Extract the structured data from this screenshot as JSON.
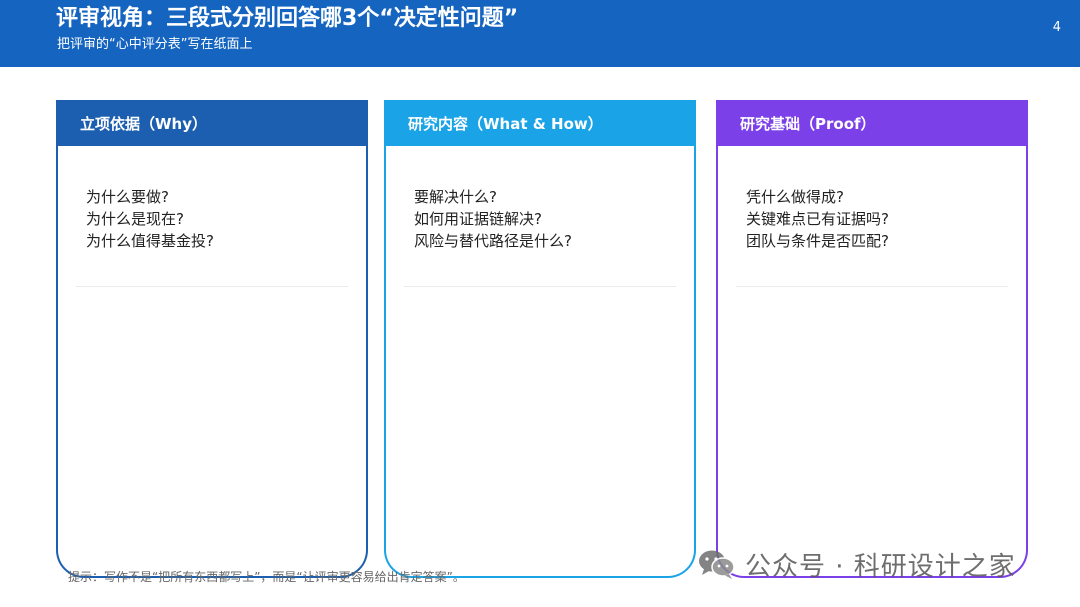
{
  "header": {
    "title": "评审视角：三段式分别回答哪3个“决定性问题”",
    "subtitle": "把评审的“心中评分表”写在纸面上",
    "page_number": "4"
  },
  "cards": [
    {
      "heading": "立项依据（Why）",
      "lines": [
        "为什么要做?",
        "为什么是现在?",
        "为什么值得基金投?"
      ]
    },
    {
      "heading": "研究内容（What & How）",
      "lines": [
        "要解决什么?",
        "如何用证据链解决?",
        "风险与替代路径是什么?"
      ]
    },
    {
      "heading": "研究基础（Proof）",
      "lines": [
        "凭什么做得成?",
        "关键难点已有证据吗?",
        "团队与条件是否匹配?"
      ]
    }
  ],
  "footer": {
    "tip": "提示：写作不是“把所有东西都写上”，而是“让评审更容易给出肯定答案”。"
  },
  "watermark": {
    "text": "公众号 · 科研设计之家",
    "icon": "wechat-icon"
  },
  "colors": {
    "header_bg": "#1565c0",
    "card_why": "#1c5fb0",
    "card_what_how": "#1aa3e6",
    "card_proof": "#7b40e8"
  }
}
